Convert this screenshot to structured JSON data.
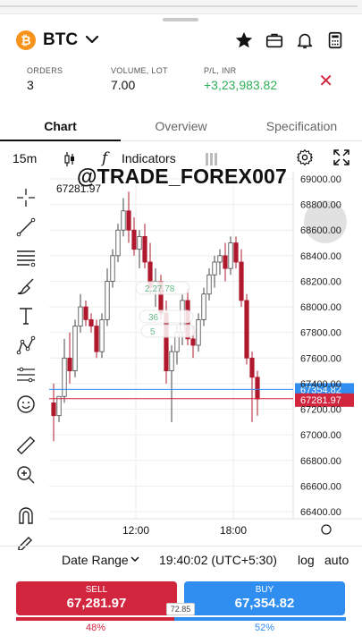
{
  "header": {
    "symbol": "BTC",
    "logo_glyph": "₿",
    "icons": [
      "star-icon",
      "portfolio-briefcase-icon",
      "bell-icon",
      "calculator-icon"
    ]
  },
  "stats": {
    "orders_label": "ORDERS",
    "orders_value": "3",
    "volume_label": "VOLUME, LOT",
    "volume_value": "7.00",
    "pl_label": "P/L, INR",
    "pl_value": "+3,23,983.82"
  },
  "tabs": [
    "Chart",
    "Overview",
    "Specification"
  ],
  "toolbar": {
    "timeframe": "15m",
    "indicators_label": "Indicators",
    "fx_glyph": "f"
  },
  "watermark": "@TRADE_FOREX007",
  "colors": {
    "sell": "#d2263f",
    "buy": "#2f8ef0",
    "up_candle": "#ffffff",
    "down_candle": "#b0182e",
    "profit_green": "#2fae58"
  },
  "chart_data": {
    "type": "candlestick",
    "y_ticks": [
      "69000.00",
      "68800.00",
      "68600.00",
      "68400.00",
      "68200.00",
      "68000.00",
      "67800.00",
      "67600.00",
      "67400.00",
      "67200.00",
      "67000.00",
      "66800.00",
      "66600.00",
      "66400.00"
    ],
    "x_ticks": [
      "12:00",
      "18:00"
    ],
    "ylim": [
      66400,
      69000
    ],
    "high_label": "67281.97",
    "bid_price": "67281.97",
    "ask_price": "67354.82",
    "ghost_labels": [
      "2.27.78",
      "36",
      "5"
    ],
    "series": [
      {
        "o": 67250,
        "h": 67400,
        "l": 66950,
        "c": 67150
      },
      {
        "o": 67150,
        "h": 67300,
        "l": 67100,
        "c": 67300
      },
      {
        "o": 67300,
        "h": 67750,
        "l": 67250,
        "c": 67600
      },
      {
        "o": 67600,
        "h": 67800,
        "l": 67400,
        "c": 67500
      },
      {
        "o": 67500,
        "h": 67900,
        "l": 67450,
        "c": 67850
      },
      {
        "o": 67850,
        "h": 68100,
        "l": 67800,
        "c": 68000
      },
      {
        "o": 68000,
        "h": 68050,
        "l": 67850,
        "c": 67900
      },
      {
        "o": 67900,
        "h": 67950,
        "l": 67800,
        "c": 67850
      },
      {
        "o": 67850,
        "h": 67900,
        "l": 67600,
        "c": 67650
      },
      {
        "o": 67650,
        "h": 67950,
        "l": 67600,
        "c": 67900
      },
      {
        "o": 67900,
        "h": 68300,
        "l": 67850,
        "c": 68200
      },
      {
        "o": 68200,
        "h": 68450,
        "l": 68150,
        "c": 68400
      },
      {
        "o": 68400,
        "h": 68650,
        "l": 68350,
        "c": 68600
      },
      {
        "o": 68600,
        "h": 68850,
        "l": 68550,
        "c": 68750
      },
      {
        "o": 68750,
        "h": 68900,
        "l": 68500,
        "c": 68600
      },
      {
        "o": 68600,
        "h": 68700,
        "l": 68400,
        "c": 68450
      },
      {
        "o": 68450,
        "h": 68600,
        "l": 68300,
        "c": 68550
      },
      {
        "o": 68550,
        "h": 68650,
        "l": 68300,
        "c": 68350
      },
      {
        "o": 68350,
        "h": 68500,
        "l": 68100,
        "c": 68150
      },
      {
        "o": 68150,
        "h": 68300,
        "l": 68000,
        "c": 68200
      },
      {
        "o": 68200,
        "h": 68250,
        "l": 67900,
        "c": 67950
      },
      {
        "o": 67950,
        "h": 68050,
        "l": 67400,
        "c": 67500
      },
      {
        "o": 67500,
        "h": 67700,
        "l": 67100,
        "c": 67650
      },
      {
        "o": 67650,
        "h": 67850,
        "l": 67550,
        "c": 67800
      },
      {
        "o": 67800,
        "h": 68100,
        "l": 67700,
        "c": 68050
      },
      {
        "o": 68050,
        "h": 68150,
        "l": 67700,
        "c": 67750
      },
      {
        "o": 67750,
        "h": 67850,
        "l": 67600,
        "c": 67700
      },
      {
        "o": 67700,
        "h": 67950,
        "l": 67650,
        "c": 67900
      },
      {
        "o": 67900,
        "h": 68150,
        "l": 67850,
        "c": 68100
      },
      {
        "o": 68100,
        "h": 68300,
        "l": 68050,
        "c": 68250
      },
      {
        "o": 68250,
        "h": 68400,
        "l": 68150,
        "c": 68350
      },
      {
        "o": 68350,
        "h": 68450,
        "l": 68250,
        "c": 68400
      },
      {
        "o": 68400,
        "h": 68500,
        "l": 68200,
        "c": 68300
      },
      {
        "o": 68300,
        "h": 68550,
        "l": 68250,
        "c": 68500
      },
      {
        "o": 68500,
        "h": 68550,
        "l": 68300,
        "c": 68350
      },
      {
        "o": 68350,
        "h": 68450,
        "l": 68000,
        "c": 68050
      },
      {
        "o": 68050,
        "h": 68100,
        "l": 67550,
        "c": 67600
      },
      {
        "o": 67600,
        "h": 67650,
        "l": 67100,
        "c": 67450
      },
      {
        "o": 67450,
        "h": 67500,
        "l": 67150,
        "c": 67280
      }
    ]
  },
  "bottom_bar": {
    "date_range": "Date Range",
    "time": "19:40:02 (UTC+5:30)",
    "log": "log",
    "auto": "auto"
  },
  "trade": {
    "sell_label": "SELL",
    "sell_price": "67,281.97",
    "buy_label": "BUY",
    "buy_price": "67,354.82",
    "spread": "72.85",
    "sell_pct": "48%",
    "buy_pct": "52%",
    "sell_ratio": 0.48
  }
}
